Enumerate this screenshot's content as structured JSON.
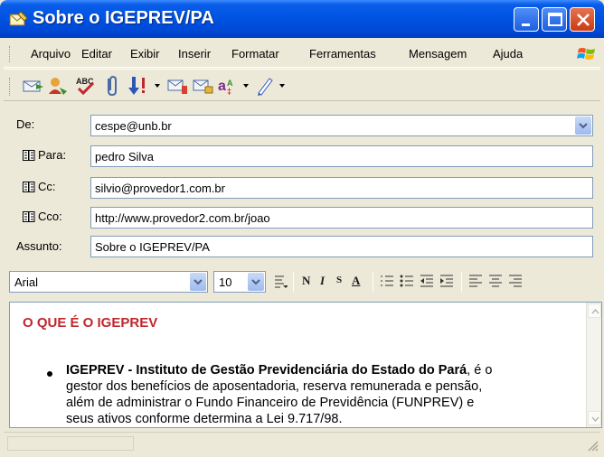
{
  "window": {
    "title": "Sobre o IGEPREV/PA"
  },
  "menu": {
    "items": [
      "Arquivo",
      "Editar",
      "Exibir",
      "Inserir",
      "Formatar",
      "Ferramentas",
      "Mensagem",
      "Ajuda"
    ]
  },
  "toolbar": {
    "icons": [
      "send-icon",
      "address-book-icon",
      "spelling-icon",
      "attach-icon",
      "priority-icon",
      "sign-icon",
      "encrypt-icon",
      "offline-icon",
      "stationery-icon"
    ]
  },
  "header": {
    "from_label": "De:",
    "from_value": "cespe@unb.br",
    "to_label": "Para:",
    "to_value": "pedro Silva",
    "cc_label": "Cc:",
    "cc_value": "silvio@provedor1.com.br",
    "bcc_label": "Cco:",
    "bcc_value": "http://www.provedor2.com.br/joao",
    "subject_label": "Assunto:",
    "subject_value": "Sobre o IGEPREV/PA"
  },
  "format": {
    "font_name": "Arial",
    "font_size": "10",
    "bold": "N",
    "italic": "I",
    "underline": "S",
    "color": "A"
  },
  "message": {
    "heading": "O QUE É O IGEPREV",
    "bold_part": "IGEPREV - Instituto de Gestão Previdenciária do Estado do Pará",
    "line1_rest": ", é o",
    "line2": "gestor dos benefícios de aposentadoria, reserva remunerada e pensão,",
    "line3": "além de administrar o Fundo Financeiro de Previdência (FUNPREV) e",
    "line4": "seus ativos conforme determina a Lei 9.717/98."
  },
  "colors": {
    "title_bar": "#0054e3",
    "heading": "#c0272d",
    "close_button": "#c93a14"
  }
}
